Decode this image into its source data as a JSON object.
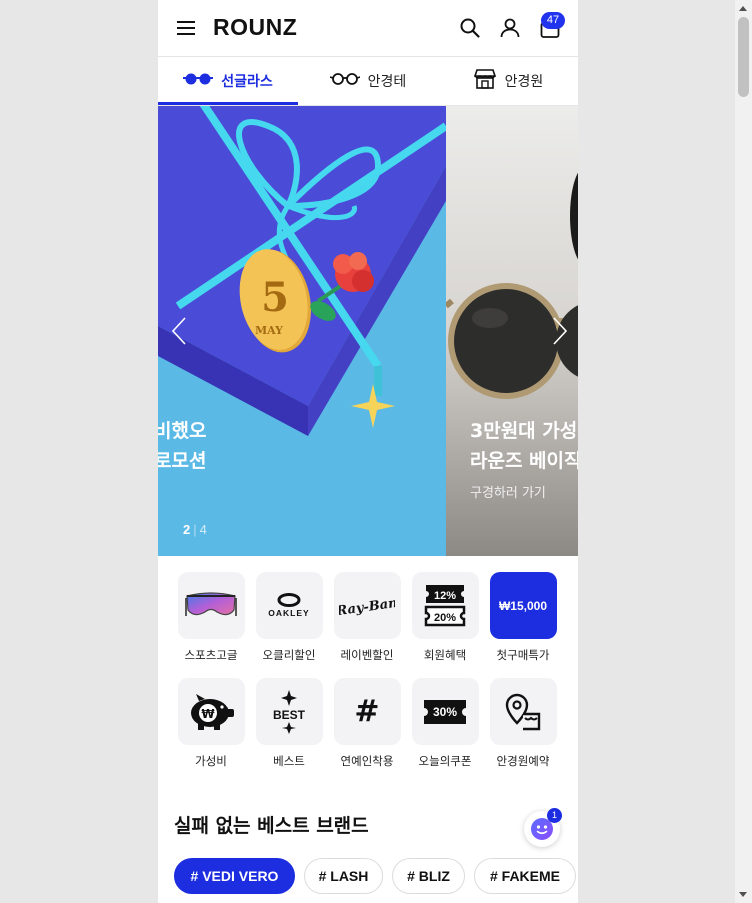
{
  "header": {
    "logo": "ROUNZ",
    "cart_count": "47"
  },
  "tabs": [
    {
      "label": "선글라스",
      "icon": "sunglasses-icon",
      "active": true
    },
    {
      "label": "안경테",
      "icon": "glasses-icon",
      "active": false
    },
    {
      "label": "안경원",
      "icon": "store-icon",
      "active": false
    }
  ],
  "banner": {
    "slide_left_title": "비했오\n로모션",
    "slide_right_title": "3만원대 가성\n라운즈 베이직",
    "slide_right_sub": "구경하러 가기",
    "gift_tag_number": "5",
    "gift_tag_month": "MAY",
    "pager_current": "2",
    "pager_separator": "|",
    "pager_total": "4"
  },
  "categories": [
    {
      "label": "스포츠고글",
      "icon": "sports-goggle-icon"
    },
    {
      "label": "오클리할인",
      "icon": "oakley-logo",
      "logo_text": "OAKLEY"
    },
    {
      "label": "레이벤할인",
      "icon": "rayban-logo",
      "logo_text": "Ray-Ban"
    },
    {
      "label": "회원혜택",
      "icon": "coupon-stack-icon",
      "top": "12%",
      "bottom": "20%"
    },
    {
      "label": "첫구매특가",
      "icon": "price-tile",
      "price": "₩15,000"
    },
    {
      "label": "가성비",
      "icon": "piggy-bank-icon",
      "symbol": "₩"
    },
    {
      "label": "베스트",
      "icon": "best-icon",
      "text": "BEST"
    },
    {
      "label": "연예인착용",
      "icon": "hashtag-icon",
      "text": "#"
    },
    {
      "label": "오늘의쿠폰",
      "icon": "coupon-icon",
      "text": "30%"
    },
    {
      "label": "안경원예약",
      "icon": "location-store-icon"
    }
  ],
  "brands": {
    "title": "실패 없는 베스트 브랜드",
    "chat_badge": "1",
    "chips": [
      "# VEDI VERO",
      "# LASH",
      "# BLIZ",
      "# FAKEME"
    ]
  },
  "colors": {
    "accent": "#1d2de0",
    "badge": "#2233ee"
  }
}
